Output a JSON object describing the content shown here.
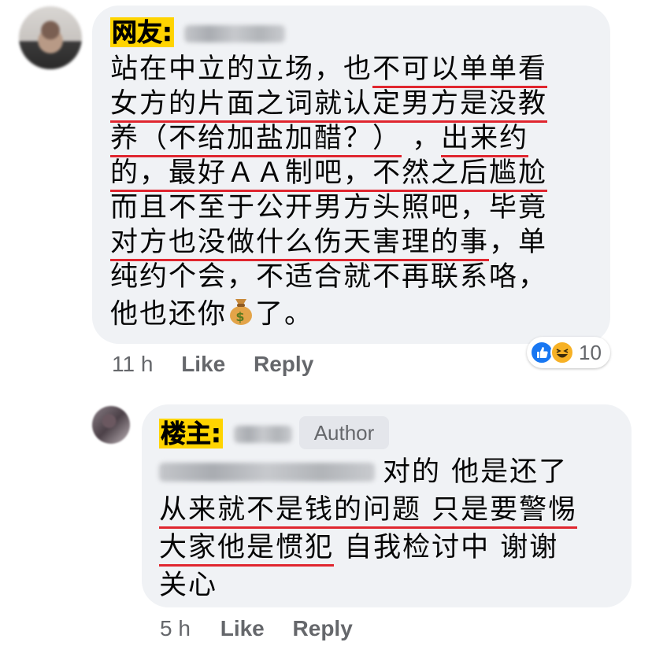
{
  "comment1": {
    "label": "网友:",
    "lines": [
      {
        "text": "站在中立的立场，也",
        "underlined": "不可以单单看"
      },
      {
        "text": "",
        "underlined": "女方的片面之词就认定男方是没教"
      },
      {
        "text": "",
        "underlined": "养（不给加盐加醋？）",
        "after": " ，",
        "underlined2": "出来约"
      },
      {
        "text": "",
        "underlined": "的，最好ＡＡ制吧，不然之后尴尬"
      },
      {
        "text": "而且不至于公开男方头照吧，毕竟",
        "underlined": ""
      },
      {
        "text": "",
        "underlined": "对方也没做什么伤天害理的事",
        "after": "，单"
      },
      {
        "text": "纯约个会，不适合就不再联系咯，",
        "underlined": ""
      },
      {
        "text": "他也还你",
        "emoji": "money-bag",
        "after": "了。"
      }
    ],
    "time": "11 h",
    "like_label": "Like",
    "reply_label": "Reply",
    "reaction_count": "10",
    "reaction_icons": [
      "like-icon",
      "haha-icon"
    ]
  },
  "comment2": {
    "label": "楼主:",
    "author_badge": "Author",
    "lines": [
      {
        "text": "对的 他是还了",
        "underlined": ""
      },
      {
        "text": "",
        "underlined": "从来就不是钱的问题 只是要警惕"
      },
      {
        "text": "",
        "underlined": "大家他是惯犯",
        "after": " 自我检讨中 谢谢"
      },
      {
        "text": "关心",
        "underlined": ""
      }
    ],
    "time": "5 h",
    "like_label": "Like",
    "reply_label": "Reply"
  },
  "colors": {
    "bubble": "#f0f2f5",
    "underline": "#e0262f",
    "highlight": "#ffd400",
    "meta": "#65676b",
    "like_blue": "#1877f2"
  }
}
